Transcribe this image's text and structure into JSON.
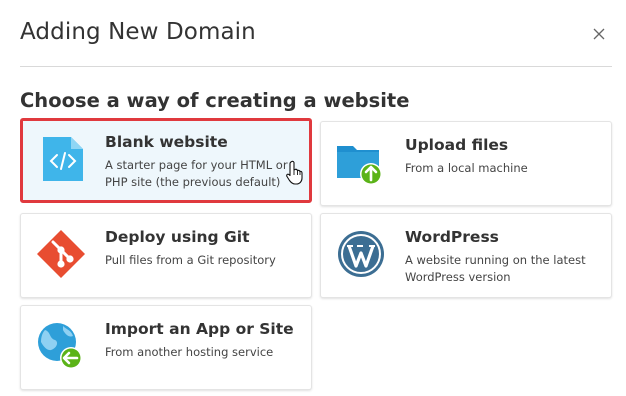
{
  "dialog": {
    "title": "Adding New Domain",
    "close_icon": "close-icon"
  },
  "section_title": "Choose a way of creating a website",
  "options": [
    {
      "title": "Blank website",
      "description": "A starter page for your HTML or PHP site (the previous default)",
      "icon": "code-file-icon",
      "selected": true
    },
    {
      "title": "Upload files",
      "description": "From a local machine",
      "icon": "folder-upload-icon",
      "selected": false
    },
    {
      "title": "Deploy using Git",
      "description": "Pull files from a Git repository",
      "icon": "git-icon",
      "selected": false
    },
    {
      "title": "WordPress",
      "description": "A website running on the latest WordPress version",
      "icon": "wordpress-icon",
      "selected": false
    },
    {
      "title": "Import an App or Site",
      "description": "From another hosting service",
      "icon": "globe-import-icon",
      "selected": false
    }
  ],
  "colors": {
    "selected_border": "#e0393e",
    "selected_bg": "#eef7fc",
    "file_blue": "#3fb5ea",
    "folder_blue": "#2e9fd9",
    "git_red": "#e84d31",
    "wordpress_blue": "#3c6e93",
    "green": "#5bb318"
  }
}
